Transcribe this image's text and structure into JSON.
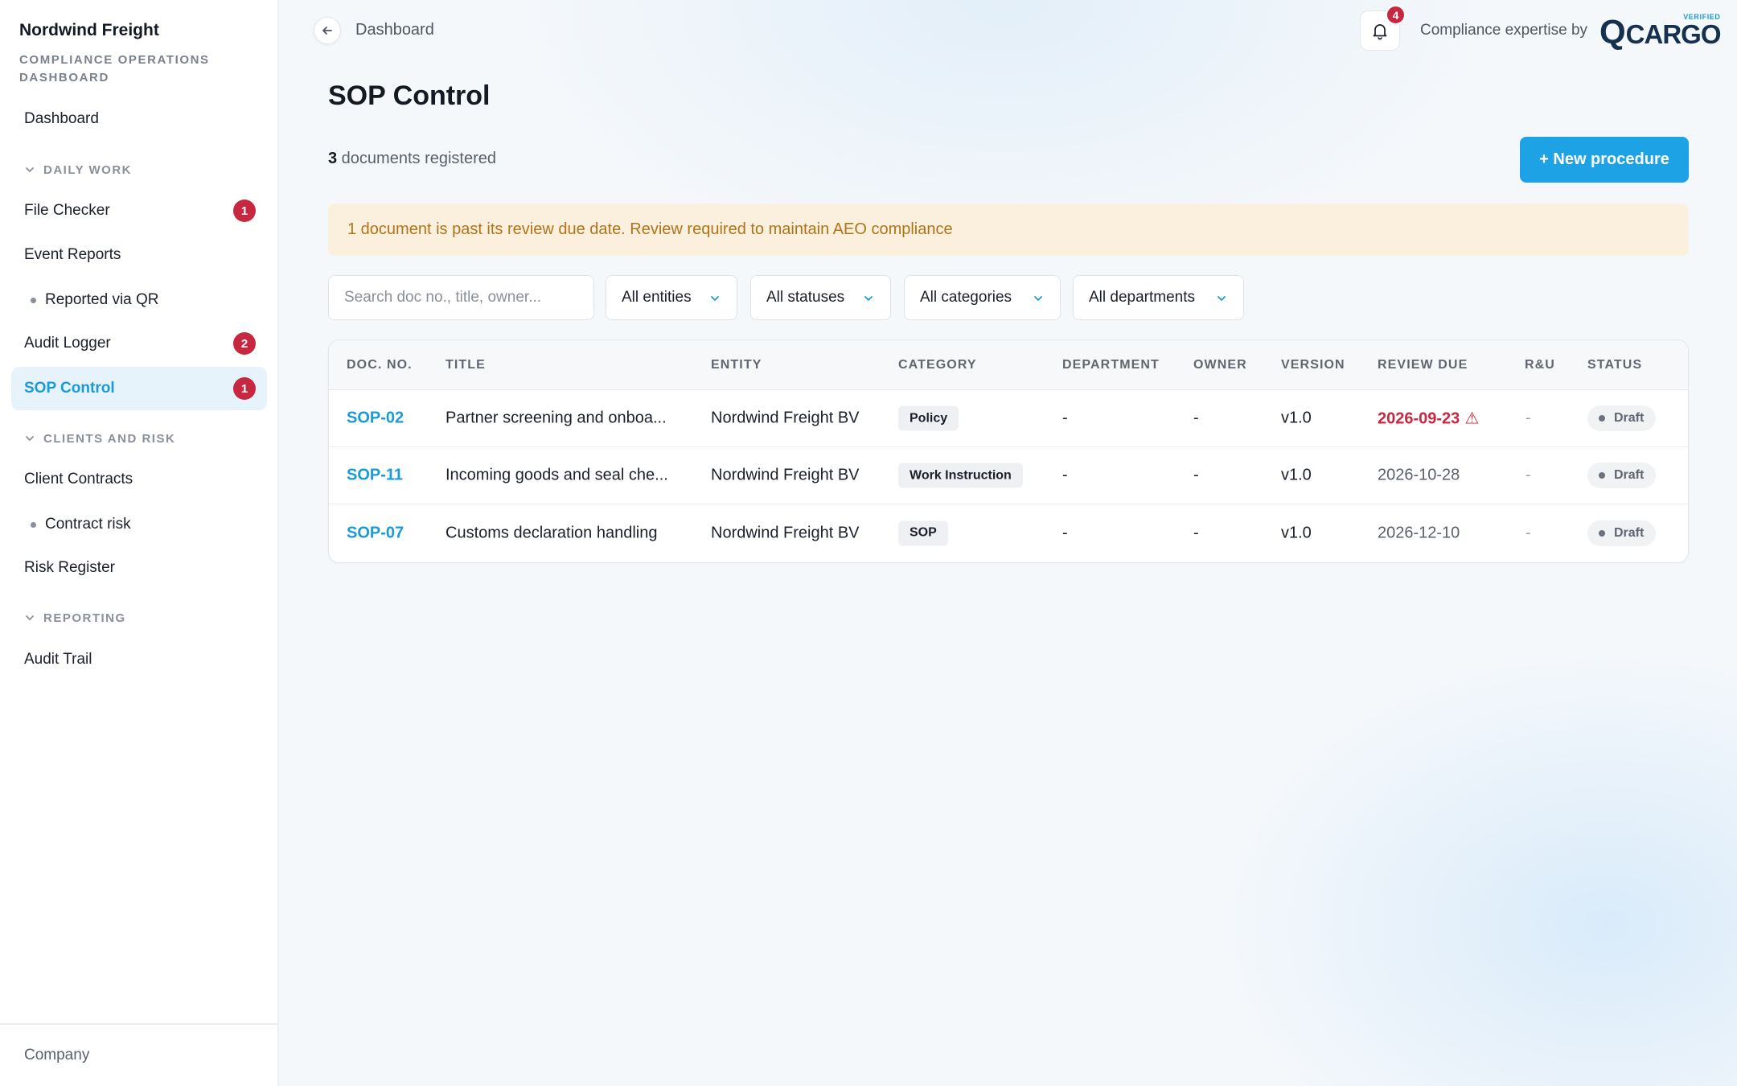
{
  "sidebar": {
    "brand_name": "Nordwind Freight",
    "brand_sub": "Compliance Operations Dashboard",
    "items": {
      "dashboard": "Dashboard",
      "section_daily": "DAILY WORK",
      "file_checker": "File Checker",
      "file_checker_badge": "1",
      "event_reports": "Event Reports",
      "reported_qr": "Reported via QR",
      "audit_logger": "Audit Logger",
      "audit_logger_badge": "2",
      "sop_control": "SOP Control",
      "sop_control_badge": "1",
      "section_clients": "CLIENTS AND RISK",
      "client_contracts": "Client Contracts",
      "contract_risk": "Contract risk",
      "risk_register": "Risk Register",
      "section_reporting": "REPORTING",
      "audit_trail": "Audit Trail"
    },
    "footer": "Company"
  },
  "header": {
    "breadcrumb": "Dashboard",
    "notification_count": "4",
    "expertise_text": "Compliance expertise by",
    "logo_text": "CARGO",
    "logo_mark": "Q",
    "logo_badge": "VERIFIED"
  },
  "main": {
    "title": "SOP Control",
    "count": "3",
    "count_suffix": " documents registered",
    "new_button": "+ New procedure",
    "alert": "1 document is past its review due date. Review required to maintain AEO compliance",
    "search_placeholder": "Search doc no., title, owner...",
    "filters": {
      "entities": "All entities",
      "statuses": "All statuses",
      "categories": "All categories",
      "departments": "All departments"
    }
  },
  "table": {
    "headers": {
      "docno": "DOC. NO.",
      "title": "TITLE",
      "entity": "ENTITY",
      "category": "CATEGORY",
      "department": "DEPARTMENT",
      "owner": "OWNER",
      "version": "VERSION",
      "review_due": "REVIEW DUE",
      "ru": "R&U",
      "status": "STATUS"
    },
    "rows": [
      {
        "docno": "SOP-02",
        "title": "Partner screening and onboa...",
        "entity": "Nordwind Freight BV",
        "category": "Policy",
        "department": "-",
        "owner": "-",
        "version": "v1.0",
        "review_due": "2026-09-23",
        "ru": "-",
        "status": "Draft"
      },
      {
        "docno": "SOP-11",
        "title": "Incoming goods and seal che...",
        "entity": "Nordwind Freight BV",
        "category": "Work Instruction",
        "department": "-",
        "owner": "-",
        "version": "v1.0",
        "review_due": "2026-10-28",
        "ru": "-",
        "status": "Draft"
      },
      {
        "docno": "SOP-07",
        "title": "Customs declaration handling",
        "entity": "Nordwind Freight BV",
        "category": "SOP",
        "department": "-",
        "owner": "-",
        "version": "v1.0",
        "review_due": "2026-12-10",
        "ru": "-",
        "status": "Draft"
      }
    ]
  },
  "colors": {
    "accent": "#1ea2e6",
    "danger": "#c8283f",
    "warning_bg": "#fbf0de",
    "warning_text": "#b07418"
  }
}
